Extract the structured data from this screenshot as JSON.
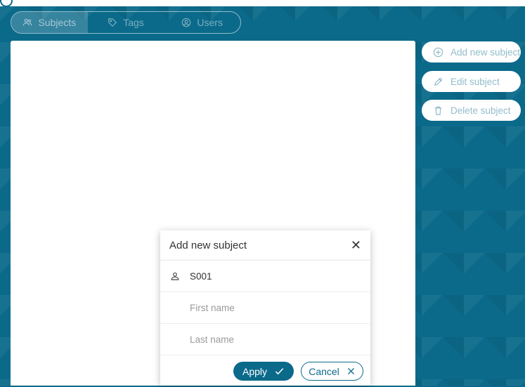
{
  "tabs": [
    {
      "label": "Subjects",
      "icon": "users-icon",
      "active": true
    },
    {
      "label": "Tags",
      "icon": "tag-icon",
      "active": false
    },
    {
      "label": "Users",
      "icon": "user-circle-icon",
      "active": false
    }
  ],
  "actions": {
    "add_label": "Add new subject",
    "edit_label": "Edit subject",
    "delete_label": "Delete subject"
  },
  "dialog": {
    "title": "Add new subject",
    "subject_id_value": "S001",
    "first_name_placeholder": "First name",
    "last_name_placeholder": "Last name",
    "apply_label": "Apply",
    "cancel_label": "Cancel"
  },
  "colors": {
    "brand": "#0b6a8a",
    "panel": "#ffffff"
  }
}
